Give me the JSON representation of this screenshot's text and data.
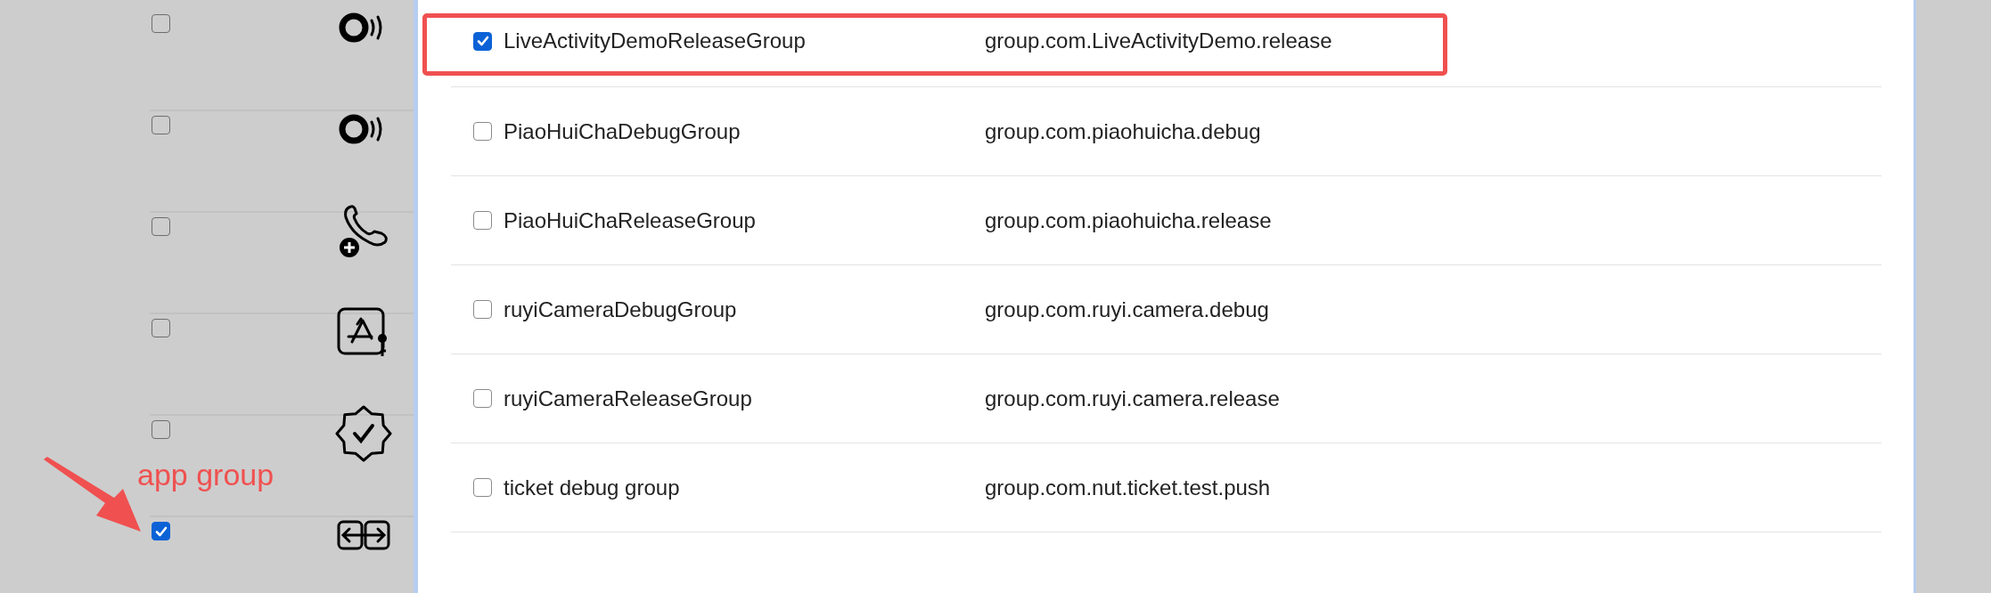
{
  "background_list": {
    "rows": [
      {
        "kind": "broadcast",
        "checked": false
      },
      {
        "kind": "broadcast",
        "checked": false
      },
      {
        "kind": "phone-plus",
        "checked": false
      },
      {
        "kind": "store-key",
        "checked": false
      },
      {
        "kind": "badge",
        "checked": false
      },
      {
        "kind": "arrows",
        "checked": true
      }
    ]
  },
  "dialog": {
    "rows": [
      {
        "name": "LiveActivityDemoReleaseGroup",
        "identifier": "group.com.LiveActivityDemo.release",
        "checked": true,
        "highlighted": true
      },
      {
        "name": "PiaoHuiChaDebugGroup",
        "identifier": "group.com.piaohuicha.debug",
        "checked": false,
        "highlighted": false
      },
      {
        "name": "PiaoHuiChaReleaseGroup",
        "identifier": "group.com.piaohuicha.release",
        "checked": false,
        "highlighted": false
      },
      {
        "name": "ruyiCameraDebugGroup",
        "identifier": "group.com.ruyi.camera.debug",
        "checked": false,
        "highlighted": false
      },
      {
        "name": "ruyiCameraReleaseGroup",
        "identifier": "group.com.ruyi.camera.release",
        "checked": false,
        "highlighted": false
      },
      {
        "name": "ticket debug group",
        "identifier": "group.com.nut.ticket.test.push",
        "checked": false,
        "highlighted": false
      }
    ]
  },
  "annotation": {
    "label": "app group"
  }
}
